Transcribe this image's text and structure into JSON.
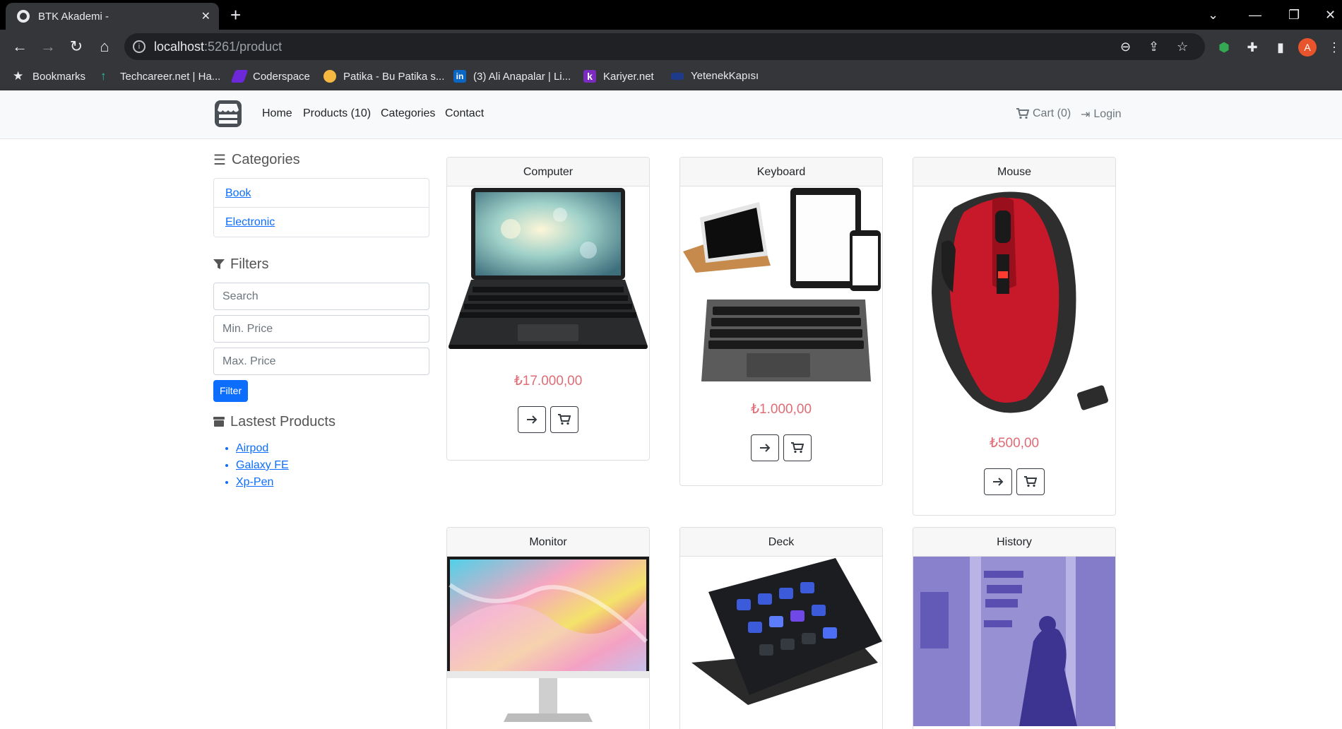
{
  "browser": {
    "tab_title": "BTK Akademi -",
    "url_host": "localhost",
    "url_path": ":5261/product",
    "bookmarks": [
      {
        "label": "Bookmarks",
        "icon": "star-icon"
      },
      {
        "label": "Techcareer.net | Ha...",
        "icon": "techcareer-icon"
      },
      {
        "label": "Coderspace",
        "icon": "coderspace-icon"
      },
      {
        "label": "Patika - Bu Patika s...",
        "icon": "patika-icon"
      },
      {
        "label": "(3) Ali Anapalar | Li...",
        "icon": "linkedin-icon"
      },
      {
        "label": "Kariyer.net",
        "icon": "kariyer-icon"
      },
      {
        "label": "YetenekKapısı",
        "icon": "yetenekkapisi-icon"
      }
    ],
    "profile_initial": "A"
  },
  "navbar": {
    "links": [
      "Home",
      "Products (10)",
      "Categories",
      "Contact"
    ],
    "cart": "Cart (0)",
    "login": "Login"
  },
  "sidebar": {
    "categories_title": "Categories",
    "categories": [
      "Book",
      "Electronic"
    ],
    "filters_title": "Filters",
    "search_placeholder": "Search",
    "min_price_placeholder": "Min. Price",
    "max_price_placeholder": "Max. Price",
    "filter_button": "Filter",
    "latest_title": "Lastest Products",
    "latest": [
      "Airpod",
      "Galaxy FE",
      "Xp-Pen"
    ]
  },
  "products": [
    {
      "name": "Computer",
      "price": "₺17.000,00",
      "image": "laptop-image"
    },
    {
      "name": "Keyboard",
      "price": "₺1.000,00",
      "image": "tablet-keyboard-image"
    },
    {
      "name": "Mouse",
      "price": "₺500,00",
      "image": "red-mouse-image"
    },
    {
      "name": "Monitor",
      "price": "",
      "image": "monitor-image"
    },
    {
      "name": "Deck",
      "price": "",
      "image": "stream-deck-image"
    },
    {
      "name": "History",
      "price": "",
      "image": "history-image"
    }
  ],
  "colors": {
    "link": "#0d6efd",
    "price": "#e06c75",
    "navbar_bg": "#f8f9fa"
  }
}
